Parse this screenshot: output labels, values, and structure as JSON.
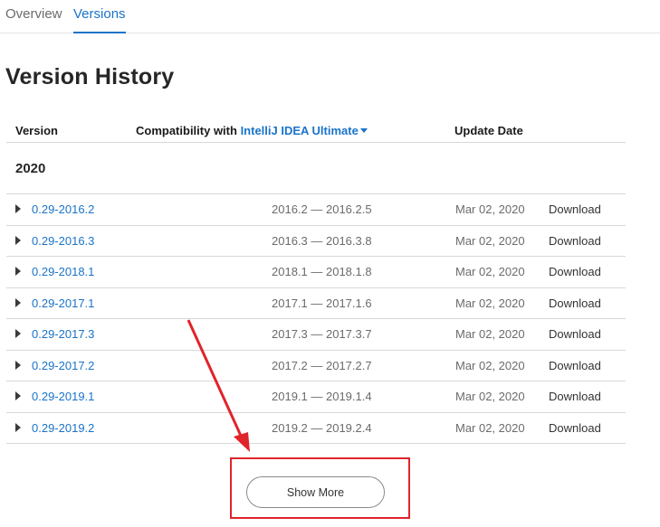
{
  "tabs": [
    {
      "label": "Overview"
    },
    {
      "label": "Versions"
    }
  ],
  "page_title": "Version History",
  "table": {
    "col_version": "Version",
    "col_compat_prefix": "Compatibility with ",
    "col_compat_product": "IntelliJ IDEA Ultimate",
    "col_date": "Update Date"
  },
  "year": "2020",
  "rows": [
    {
      "version": "0.29-2016.2",
      "compat": "2016.2 — 2016.2.5",
      "date": "Mar 02, 2020",
      "download": "Download"
    },
    {
      "version": "0.29-2016.3",
      "compat": "2016.3 — 2016.3.8",
      "date": "Mar 02, 2020",
      "download": "Download"
    },
    {
      "version": "0.29-2018.1",
      "compat": "2018.1 — 2018.1.8",
      "date": "Mar 02, 2020",
      "download": "Download"
    },
    {
      "version": "0.29-2017.1",
      "compat": "2017.1 — 2017.1.6",
      "date": "Mar 02, 2020",
      "download": "Download"
    },
    {
      "version": "0.29-2017.3",
      "compat": "2017.3 — 2017.3.7",
      "date": "Mar 02, 2020",
      "download": "Download"
    },
    {
      "version": "0.29-2017.2",
      "compat": "2017.2 — 2017.2.7",
      "date": "Mar 02, 2020",
      "download": "Download"
    },
    {
      "version": "0.29-2019.1",
      "compat": "2019.1 — 2019.1.4",
      "date": "Mar 02, 2020",
      "download": "Download"
    },
    {
      "version": "0.29-2019.2",
      "compat": "2019.2 — 2019.2.4",
      "date": "Mar 02, 2020",
      "download": "Download"
    }
  ],
  "show_more_label": "Show More",
  "colors": {
    "link": "#1a73c8",
    "annotation": "#e0242a"
  },
  "icons": {
    "row_expand": "triangle-right-icon",
    "dropdown": "caret-down-icon"
  }
}
